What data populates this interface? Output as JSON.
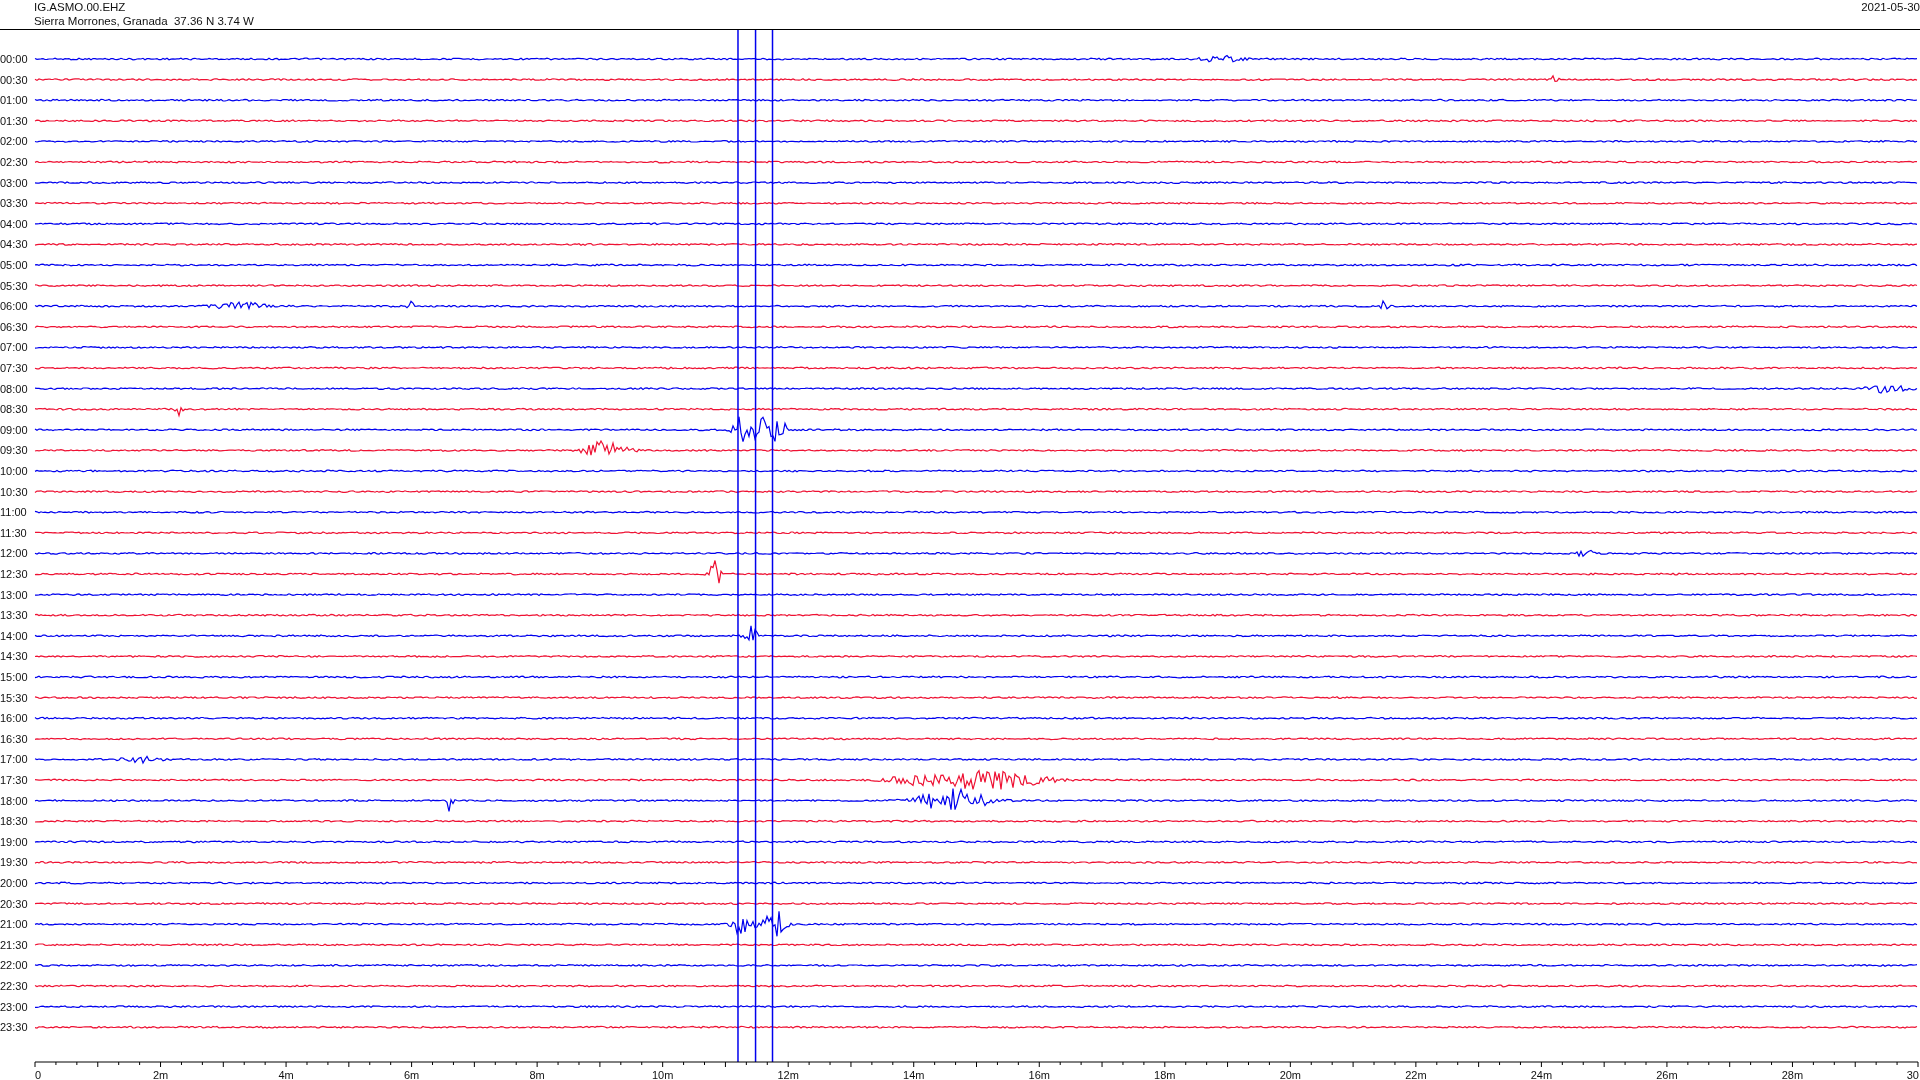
{
  "header": {
    "station": "IG.ASMO.00.EHZ",
    "location": "Sierra Morrones, Granada  37.36 N 3.74 W",
    "date": "2021-05-30"
  },
  "traces": [
    {
      "label": "00:00",
      "color": "#0000ee"
    },
    {
      "label": "00:30",
      "color": "#ee1133"
    },
    {
      "label": "01:00",
      "color": "#0000ee"
    },
    {
      "label": "01:30",
      "color": "#ee1133"
    },
    {
      "label": "02:00",
      "color": "#0000ee"
    },
    {
      "label": "02:30",
      "color": "#ee1133"
    },
    {
      "label": "03:00",
      "color": "#0000ee"
    },
    {
      "label": "03:30",
      "color": "#ee1133"
    },
    {
      "label": "04:00",
      "color": "#0000ee"
    },
    {
      "label": "04:30",
      "color": "#ee1133"
    },
    {
      "label": "05:00",
      "color": "#0000ee"
    },
    {
      "label": "05:30",
      "color": "#ee1133"
    },
    {
      "label": "06:00",
      "color": "#0000ee"
    },
    {
      "label": "06:30",
      "color": "#ee1133"
    },
    {
      "label": "07:00",
      "color": "#0000ee"
    },
    {
      "label": "07:30",
      "color": "#ee1133"
    },
    {
      "label": "08:00",
      "color": "#0000ee"
    },
    {
      "label": "08:30",
      "color": "#ee1133"
    },
    {
      "label": "09:00",
      "color": "#0000ee"
    },
    {
      "label": "09:30",
      "color": "#ee1133"
    },
    {
      "label": "10:00",
      "color": "#0000ee"
    },
    {
      "label": "10:30",
      "color": "#ee1133"
    },
    {
      "label": "11:00",
      "color": "#0000ee"
    },
    {
      "label": "11:30",
      "color": "#ee1133"
    },
    {
      "label": "12:00",
      "color": "#0000ee"
    },
    {
      "label": "12:30",
      "color": "#ee1133"
    },
    {
      "label": "13:00",
      "color": "#0000ee"
    },
    {
      "label": "13:30",
      "color": "#ee1133"
    },
    {
      "label": "14:00",
      "color": "#0000ee"
    },
    {
      "label": "14:30",
      "color": "#ee1133"
    },
    {
      "label": "15:00",
      "color": "#0000ee"
    },
    {
      "label": "15:30",
      "color": "#ee1133"
    },
    {
      "label": "16:00",
      "color": "#0000ee"
    },
    {
      "label": "16:30",
      "color": "#ee1133"
    },
    {
      "label": "17:00",
      "color": "#0000ee"
    },
    {
      "label": "17:30",
      "color": "#ee1133"
    },
    {
      "label": "18:00",
      "color": "#0000ee"
    },
    {
      "label": "18:30",
      "color": "#ee1133"
    },
    {
      "label": "19:00",
      "color": "#0000ee"
    },
    {
      "label": "19:30",
      "color": "#ee1133"
    },
    {
      "label": "20:00",
      "color": "#0000ee"
    },
    {
      "label": "20:30",
      "color": "#ee1133"
    },
    {
      "label": "21:00",
      "color": "#0000ee"
    },
    {
      "label": "21:30",
      "color": "#ee1133"
    },
    {
      "label": "22:00",
      "color": "#0000ee"
    },
    {
      "label": "22:30",
      "color": "#ee1133"
    },
    {
      "label": "23:00",
      "color": "#0000ee"
    },
    {
      "label": "23:30",
      "color": "#ee1133"
    }
  ],
  "time_axis": {
    "ticks": [
      "0",
      "2m",
      "4m",
      "6m",
      "8m",
      "10m",
      "12m",
      "14m",
      "16m",
      "18m",
      "20m",
      "22m",
      "24m",
      "26m",
      "28m",
      "30"
    ]
  }
}
